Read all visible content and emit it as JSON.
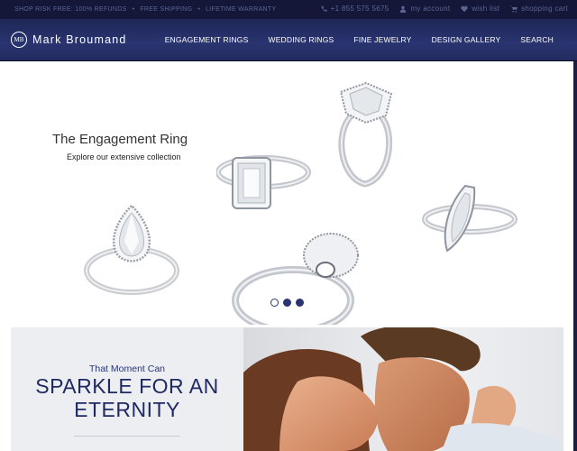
{
  "topbar": {
    "promo_items": [
      "Shop Risk Free: 100% Refunds",
      "Free Shipping",
      "Lifetime Warranty"
    ],
    "phone": "+1 855 575 5675",
    "account": "my account",
    "wishlist": "wish list",
    "cart": "shopping cart"
  },
  "header": {
    "logo_mark": "MB",
    "logo_text": "Mark Broumand",
    "menu": [
      "ENGAGEMENT RINGS",
      "WEDDING RINGS",
      "FINE JEWELRY",
      "DESIGN GALLERY",
      "SEARCH"
    ]
  },
  "hero": {
    "title": "The Engagement Ring",
    "subtitle": "Explore our extensive collection",
    "slide_count": 3,
    "active_slide": 2
  },
  "banner": {
    "kicker": "That Moment Can",
    "headline_line1": "SPARKLE FOR AN",
    "headline_line2": "ETERNITY"
  },
  "colors": {
    "nav": "#2a3470",
    "topbar": "#141737",
    "headline": "#1f2a63"
  }
}
